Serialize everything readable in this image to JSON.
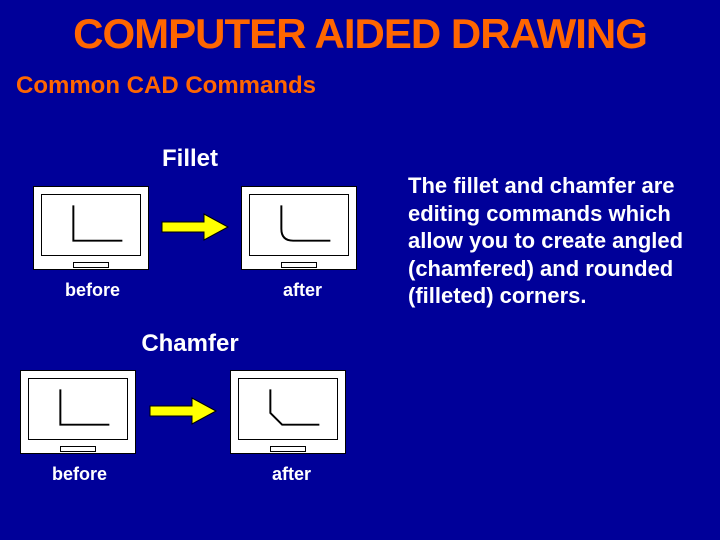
{
  "title": "COMPUTER AIDED DRAWING",
  "subtitle": "Common CAD Commands",
  "sections": {
    "fillet": {
      "label": "Fillet",
      "before": "before",
      "after": "after"
    },
    "chamfer": {
      "label": "Chamfer",
      "before": "before",
      "after": "after"
    }
  },
  "bodytext": "The fillet and chamfer are editing commands which allow you to create angled (chamfered) and rounded (filleted) corners."
}
